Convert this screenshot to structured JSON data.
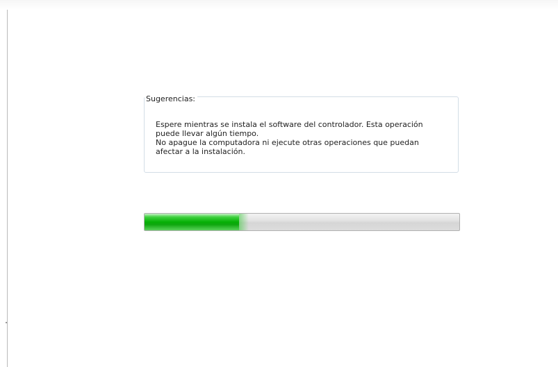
{
  "suggestions": {
    "legend": "Sugerencias:",
    "lines": [
      "Espere mientras se instala el software del controlador. Esta operación",
      "puede llevar algún tiempo.",
      "No apague la computadora ni ejecute otras operaciones que puedan",
      "afectar a la instalación."
    ]
  },
  "progress": {
    "fraction": 0.3,
    "fill_color": "#0aad0a"
  }
}
